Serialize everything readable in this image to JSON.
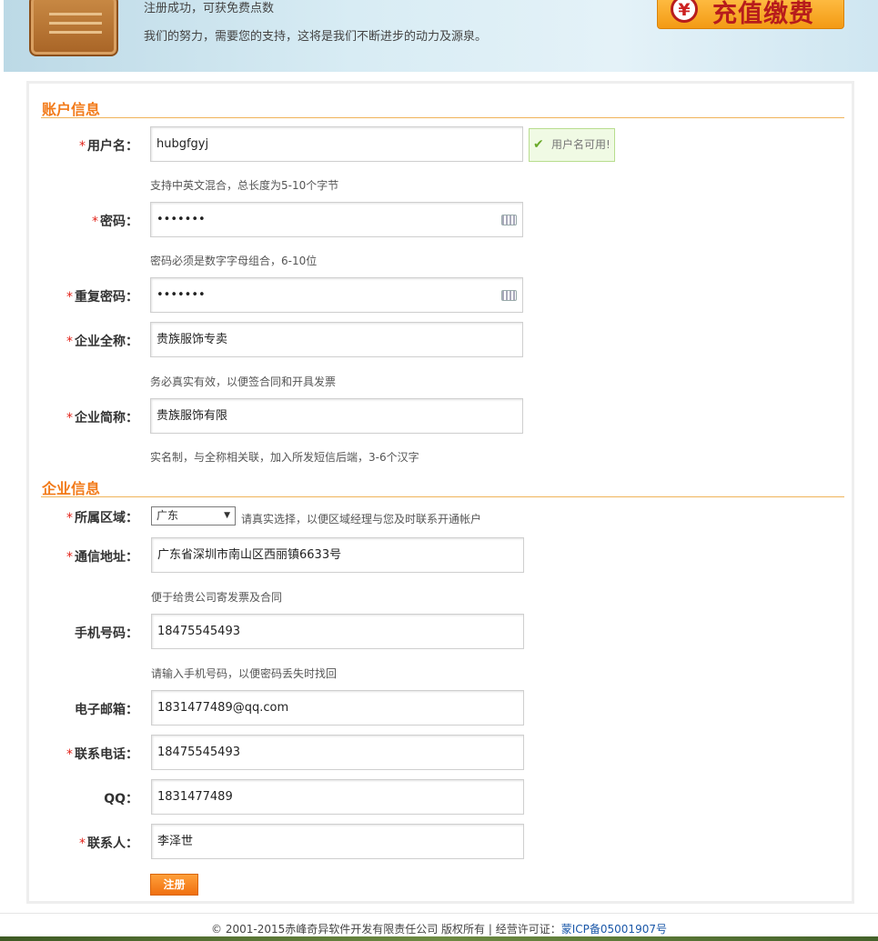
{
  "banner": {
    "line1": "注册成功，可获免费点数",
    "line2": "我们的努力，需要您的支持，这将是我们不断进步的动力及源泉。",
    "recharge_symbol": "¥",
    "recharge_label": "充值缴费"
  },
  "account_section": {
    "title": "账户信息",
    "username": {
      "label": "用户名：",
      "value": "hubgfgyj",
      "hint": "支持中英文混合，总长度为5-10个字节",
      "ok_tip": "用户名可用!"
    },
    "password": {
      "label": "密码：",
      "value": "•••••••",
      "hint": "密码必须是数字字母组合，6-10位"
    },
    "confirm_password": {
      "label": "重复密码：",
      "value": "•••••••"
    },
    "company_full": {
      "label": "企业全称：",
      "value": "贵族服饰专卖",
      "hint": "务必真实有效，以便签合同和开具发票"
    },
    "company_short": {
      "label": "企业简称：",
      "value": "贵族服饰有限",
      "hint": "实名制，与全称相关联，加入所发短信后端，3-6个汉字"
    }
  },
  "company_section": {
    "title": "企业信息",
    "region": {
      "label": "所属区域：",
      "selected": "广东",
      "hint": "请真实选择，以便区域经理与您及时联系开通帐户"
    },
    "address": {
      "label": "通信地址：",
      "value": "广东省深圳市南山区西丽镇6633号",
      "hint": "便于给贵公司寄发票及合同"
    },
    "mobile": {
      "label": "手机号码：",
      "value": "18475545493",
      "hint": "请输入手机号码，以便密码丢失时找回"
    },
    "email": {
      "label": "电子邮箱：",
      "value": "1831477489@qq.com"
    },
    "phone": {
      "label": "联系电话：",
      "value": "18475545493"
    },
    "qq": {
      "label": "QQ：",
      "value": "1831477489"
    },
    "contact": {
      "label": "联系人：",
      "value": "李泽世"
    }
  },
  "required_mark": "*",
  "submit_label": "注册",
  "footer": {
    "text": "© 2001-2015赤峰奇异软件开发有限责任公司 版权所有 | 经营许可证：",
    "icp": "蒙ICP备05001907号"
  },
  "colors": {
    "accent": "#f27a19",
    "required": "#e2231a",
    "link": "#1a57a8"
  }
}
